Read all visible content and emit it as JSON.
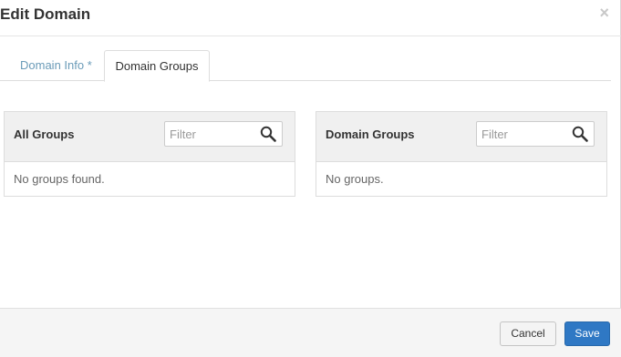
{
  "header": {
    "title": "Edit Domain",
    "close_glyph": "×"
  },
  "tabs": [
    {
      "label": "Domain Info *"
    },
    {
      "label": "Domain Groups"
    }
  ],
  "all_groups": {
    "title": "All Groups",
    "filter_placeholder": "Filter",
    "empty_text": "No groups found."
  },
  "domain_groups": {
    "title": "Domain Groups",
    "filter_placeholder": "Filter",
    "empty_text": "No groups."
  },
  "footer": {
    "cancel_label": "Cancel",
    "save_label": "Save"
  },
  "colors": {
    "tab_link": "#6a9bb8",
    "save_button": "#2f78c4",
    "panel_header": "#f0f0f0"
  }
}
